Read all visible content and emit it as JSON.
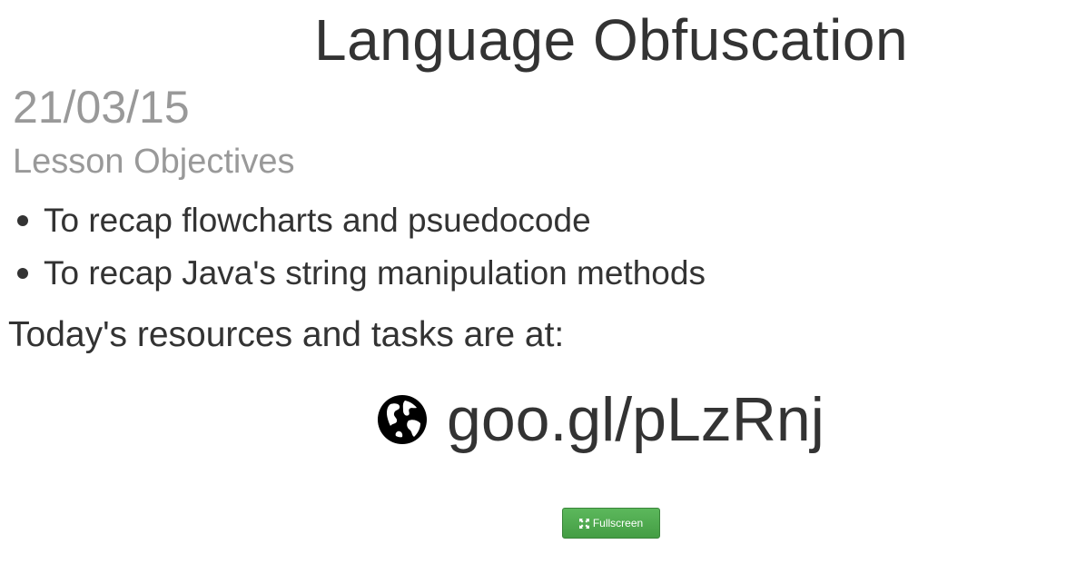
{
  "slide": {
    "title": "Language Obfuscation",
    "date": "21/03/15",
    "subtitle": "Lesson Objectives",
    "objectives": [
      "To recap flowcharts and psuedocode",
      "To recap Java's string manipulation methods"
    ],
    "resources_text": "Today's resources and tasks are at:",
    "link": {
      "icon": "globe-icon",
      "text": "goo.gl/pLzRnj"
    }
  },
  "controls": {
    "fullscreen_label": "Fullscreen",
    "fullscreen_icon": "expand-icon",
    "accent_color": "#5cb85c"
  }
}
